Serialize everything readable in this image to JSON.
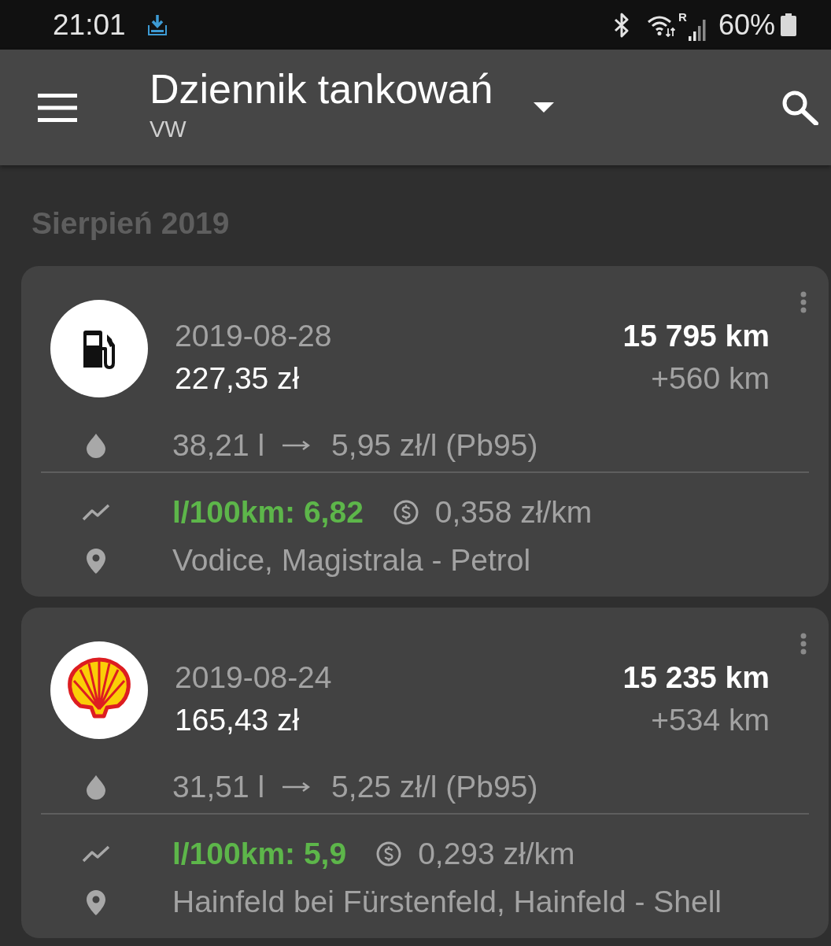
{
  "status_bar": {
    "time": "21:01",
    "roaming_label": "R",
    "battery": "60%"
  },
  "app_bar": {
    "title": "Dziennik tankowań",
    "subtitle": "VW"
  },
  "sections": [
    {
      "heading": "Sierpień 2019",
      "entries": [
        {
          "kind": "pump",
          "date": "2019-08-28",
          "cost": "227,35 zł",
          "odometer": "15 795 km",
          "distance": "+560 km",
          "volume": "38,21 l",
          "unit_price": "5,95 zł/l (Pb95)",
          "consumption": "l/100km: 6,82",
          "cost_per_km": "0,358 zł/km",
          "location": "Vodice, Magistrala - Petrol"
        },
        {
          "kind": "scallop",
          "date": "2019-08-24",
          "cost": "165,43 zł",
          "odometer": "15 235 km",
          "distance": "+534 km",
          "volume": "31,51 l",
          "unit_price": "5,25 zł/l (Pb95)",
          "consumption": "l/100km: 5,9",
          "cost_per_km": "0,293 zł/km",
          "location": "Hainfeld bei Fürstenfeld, Hainfeld - Shell"
        }
      ]
    }
  ]
}
